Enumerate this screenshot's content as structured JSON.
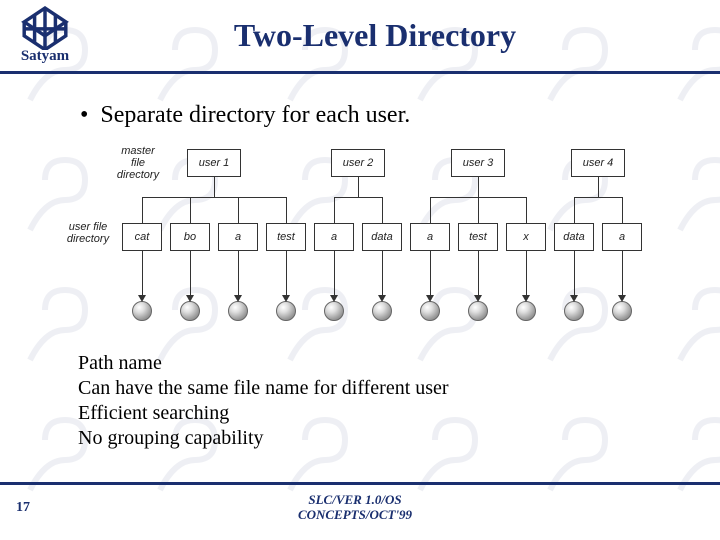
{
  "header": {
    "logo_text": "Satyam",
    "title": "Two-Level Directory"
  },
  "bullet": "Separate directory for each user.",
  "diagram": {
    "mfd_label": "master\nfile\ndirectory",
    "ufd_label": "user file\ndirectory",
    "users": [
      "user 1",
      "user 2",
      "user 3",
      "user 4"
    ],
    "files": [
      "cat",
      "bo",
      "a",
      "test",
      "a",
      "data",
      "a",
      "test",
      "x",
      "data",
      "a"
    ],
    "groups": [
      [
        0,
        1,
        2,
        3
      ],
      [
        4,
        5
      ],
      [
        6,
        7,
        8
      ],
      [
        9,
        10
      ]
    ]
  },
  "notes": [
    "Path name",
    "Can have the same file name for different user",
    "Efficient searching",
    "No grouping capability"
  ],
  "footer": {
    "page": "17",
    "line1": "SLC/VER 1.0/OS",
    "line2": "CONCEPTS/OCT'99"
  }
}
